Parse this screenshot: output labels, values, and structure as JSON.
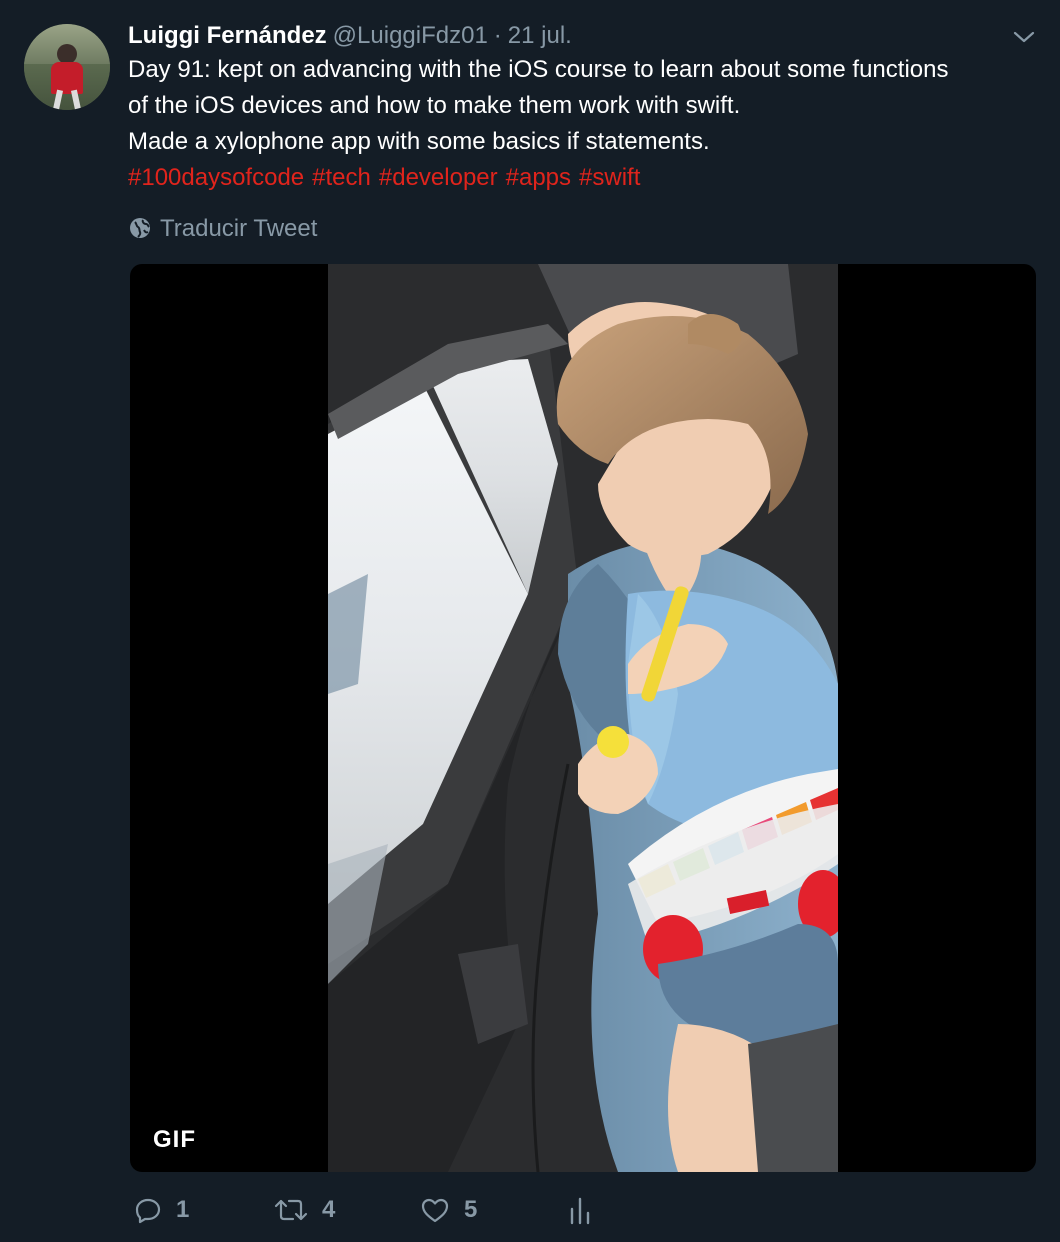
{
  "tweet": {
    "author_name": "Luiggi Fernández",
    "author_handle": "@LuiggiFdz01",
    "separator": "·",
    "date": "21 jul.",
    "text_lines": [
      "Day 91: kept on advancing with the iOS course to learn about some functions",
      "of the iOS devices and how to make them work with swift.",
      "Made a xylophone app with some basics if statements."
    ],
    "hashtags": [
      "#100daysofcode",
      "#tech",
      "#developer",
      "#apps",
      "#swift"
    ],
    "translate_label": "Traducir Tweet",
    "media": {
      "badge": "GIF"
    },
    "actions": {
      "replies": "1",
      "retweets": "4",
      "likes": "5"
    }
  },
  "colors": {
    "background": "#141d26",
    "hashtag": "#e0241c",
    "muted": "#8899a6",
    "text": "#ffffff"
  },
  "icons": {
    "caret": "chevron-down-icon",
    "translate": "globe-icon",
    "reply": "reply-icon",
    "retweet": "retweet-icon",
    "like": "heart-icon",
    "analytics": "analytics-icon"
  }
}
